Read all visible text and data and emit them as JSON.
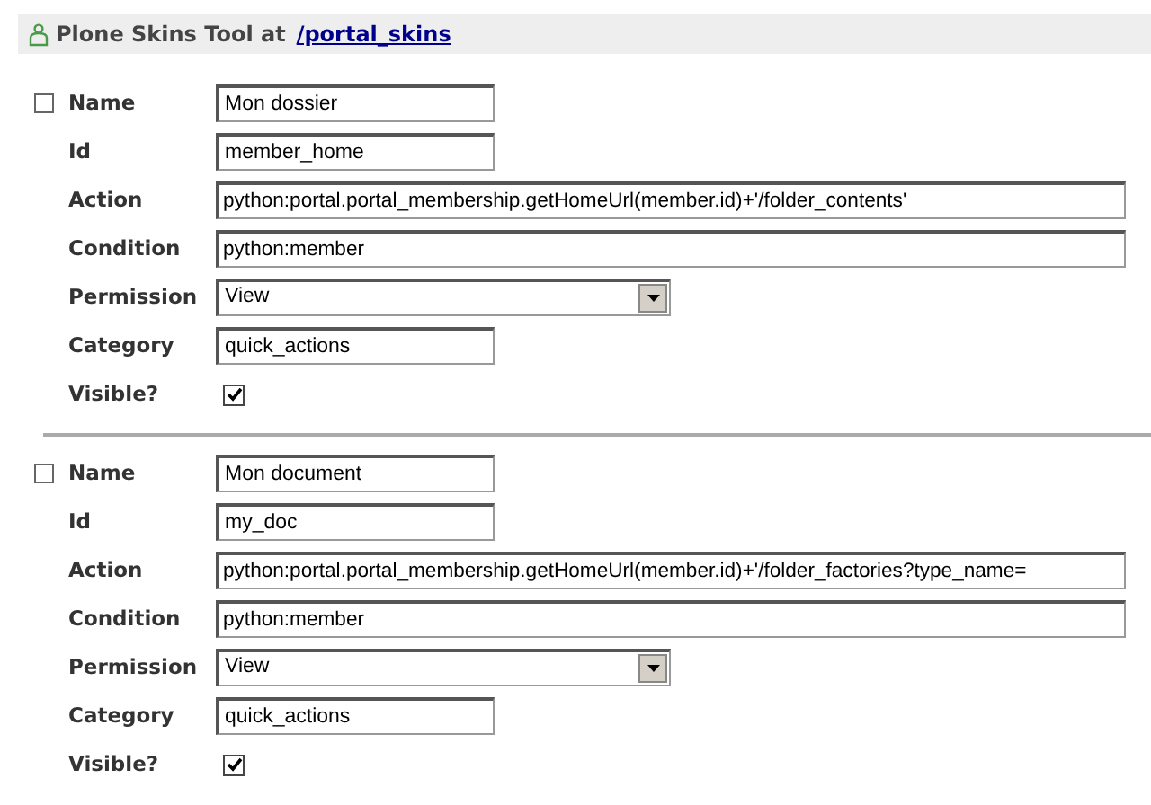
{
  "header": {
    "title": "Plone Skins Tool at",
    "link": "/portal_skins"
  },
  "entries": [
    {
      "selected": false,
      "fields": [
        {
          "kind": "short",
          "label": "Name",
          "value": "Mon dossier"
        },
        {
          "kind": "short",
          "label": "Id",
          "value": "member_home"
        },
        {
          "kind": "wide",
          "label": "Action",
          "value": "python:portal.portal_membership.getHomeUrl(member.id)+'/folder_contents'"
        },
        {
          "kind": "wide",
          "label": "Condition",
          "value": "python:member"
        },
        {
          "kind": "select",
          "label": "Permission",
          "value": "View"
        },
        {
          "kind": "short",
          "label": "Category",
          "value": "quick_actions"
        },
        {
          "kind": "checkbox",
          "label": "Visible?",
          "checked": true
        }
      ]
    },
    {
      "selected": false,
      "fields": [
        {
          "kind": "short",
          "label": "Name",
          "value": "Mon document"
        },
        {
          "kind": "short",
          "label": "Id",
          "value": "my_doc"
        },
        {
          "kind": "wide",
          "label": "Action",
          "value": "python:portal.portal_membership.getHomeUrl(member.id)+'/folder_factories?type_name="
        },
        {
          "kind": "wide",
          "label": "Condition",
          "value": "python:member"
        },
        {
          "kind": "select",
          "label": "Permission",
          "value": "View"
        },
        {
          "kind": "short",
          "label": "Category",
          "value": "quick_actions"
        },
        {
          "kind": "checkbox",
          "label": "Visible?",
          "checked": true
        }
      ]
    }
  ]
}
